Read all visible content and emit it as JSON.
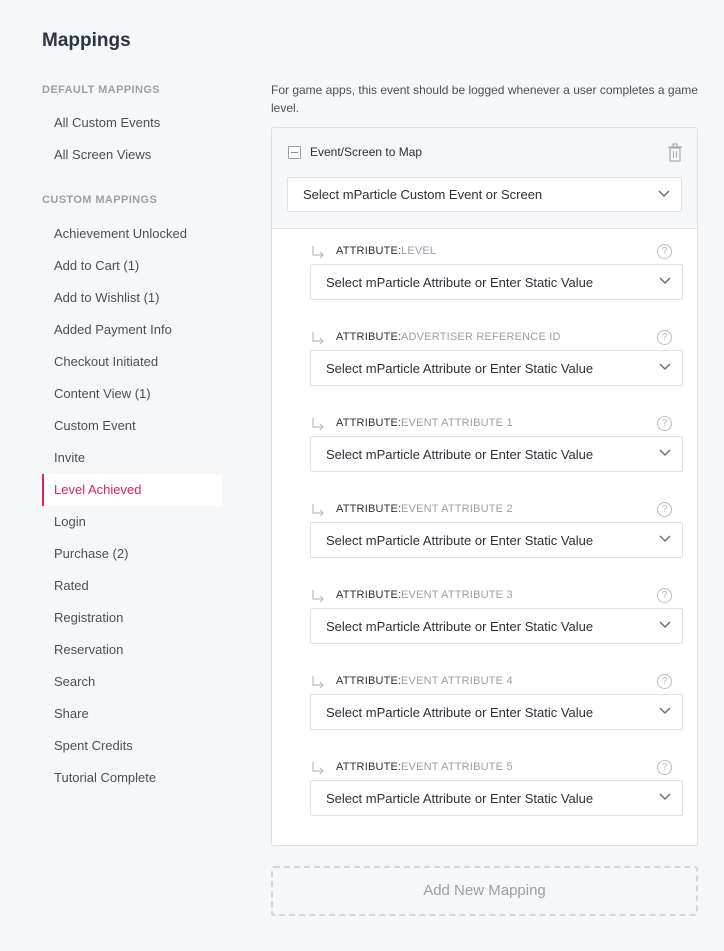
{
  "page": {
    "title": "Mappings"
  },
  "sidebar": {
    "default_header": "DEFAULT MAPPINGS",
    "default_items": [
      {
        "label": "All Custom Events"
      },
      {
        "label": "All Screen Views"
      }
    ],
    "custom_header": "CUSTOM MAPPINGS",
    "custom_items": [
      {
        "label": "Achievement Unlocked"
      },
      {
        "label": "Add to Cart (1)"
      },
      {
        "label": "Add to Wishlist (1)"
      },
      {
        "label": "Added Payment Info"
      },
      {
        "label": "Checkout Initiated"
      },
      {
        "label": "Content View (1)"
      },
      {
        "label": "Custom Event"
      },
      {
        "label": "Invite"
      },
      {
        "label": "Level Achieved",
        "active": true
      },
      {
        "label": "Login"
      },
      {
        "label": "Purchase (2)"
      },
      {
        "label": "Rated"
      },
      {
        "label": "Registration"
      },
      {
        "label": "Reservation"
      },
      {
        "label": "Search"
      },
      {
        "label": "Share"
      },
      {
        "label": "Spent Credits"
      },
      {
        "label": "Tutorial Complete"
      }
    ]
  },
  "main": {
    "description": "For game apps, this event should be logged whenever a user completes a game level.",
    "event_label": "Event/Screen to Map",
    "event_select_placeholder": "Select mParticle Custom Event or Screen",
    "attribute_key_label": "ATTRIBUTE:",
    "attributes": [
      {
        "name": "LEVEL",
        "placeholder": "Select mParticle Attribute or Enter Static Value"
      },
      {
        "name": "ADVERTISER REFERENCE ID",
        "placeholder": "Select mParticle Attribute or Enter Static Value"
      },
      {
        "name": "EVENT ATTRIBUTE 1",
        "placeholder": "Select mParticle Attribute or Enter Static Value"
      },
      {
        "name": "EVENT ATTRIBUTE 2",
        "placeholder": "Select mParticle Attribute or Enter Static Value"
      },
      {
        "name": "EVENT ATTRIBUTE 3",
        "placeholder": "Select mParticle Attribute or Enter Static Value"
      },
      {
        "name": "EVENT ATTRIBUTE 4",
        "placeholder": "Select mParticle Attribute or Enter Static Value"
      },
      {
        "name": "EVENT ATTRIBUTE 5",
        "placeholder": "Select mParticle Attribute or Enter Static Value"
      }
    ],
    "help_glyph": "?",
    "add_mapping_label": "Add New Mapping"
  },
  "colors": {
    "accent": "#e0215b",
    "background": "#f6f7f9",
    "muted_text": "#9aa0a8"
  },
  "icons": {
    "collapse": "collapse-icon",
    "trash": "trash-icon",
    "chevron": "chevron-down-icon",
    "arrow": "return-arrow-icon",
    "help": "help-icon"
  }
}
